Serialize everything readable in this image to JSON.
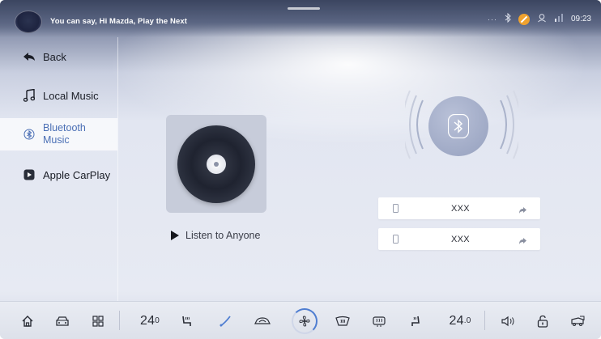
{
  "status_bar": {
    "voice_hint": "You can say, Hi Mazda, Play the Next",
    "more": "···",
    "time": "09:23"
  },
  "nav": {
    "back": "Back",
    "items": [
      {
        "label": "Local Music",
        "icon": "music-note-icon",
        "active": false
      },
      {
        "label": "Bluetooth Music",
        "icon": "bluetooth-icon",
        "active": true
      },
      {
        "label": "Apple CarPlay",
        "icon": "carplay-icon",
        "active": false
      }
    ]
  },
  "player": {
    "listen_label": "Listen to Anyone"
  },
  "devices": [
    {
      "name": "XXX",
      "icon": "phone-icon",
      "action_icon": "share-arrow-icon"
    },
    {
      "name": "XXX",
      "icon": "phone-icon",
      "action_icon": "share-arrow-icon"
    }
  ],
  "dock": {
    "left_temp": "24",
    "left_temp_unit": "0",
    "right_temp": "24",
    "right_temp_unit": ".0",
    "icons": [
      "home-icon",
      "car-icon",
      "apps-grid-icon",
      "seat-heat-icon",
      "wiper-icon",
      "recirculation-icon",
      "fan-icon",
      "defrost-front-icon",
      "defrost-rear-icon",
      "seat-vent-icon",
      "volume-icon",
      "lock-icon",
      "car-settings-icon"
    ]
  },
  "colors": {
    "accent": "#4a6fb5",
    "mute_badge": "#f0a22e"
  }
}
